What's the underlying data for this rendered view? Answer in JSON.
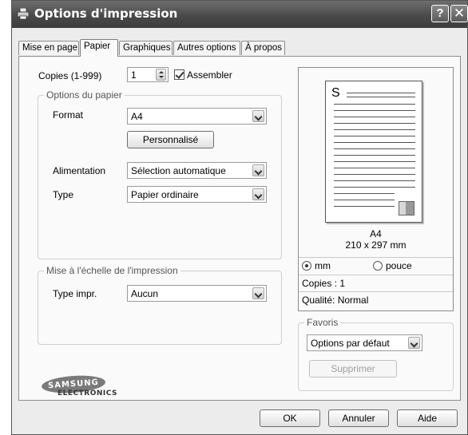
{
  "window": {
    "title": "Options d'impression",
    "help_glyph": "?",
    "close_glyph": "✕"
  },
  "tabs": [
    {
      "label": "Mise en page",
      "active": false
    },
    {
      "label": "Papier",
      "active": true
    },
    {
      "label": "Graphiques",
      "active": false
    },
    {
      "label": "Autres options",
      "active": false
    },
    {
      "label": "À propos",
      "active": false
    }
  ],
  "copies": {
    "label": "Copies (1-999)",
    "value": "1",
    "collate_label": "Assembler",
    "collate_checked": true
  },
  "paper_options": {
    "group_title": "Options du papier",
    "format_label": "Format",
    "format_value": "A4",
    "custom_button": "Personnalisé",
    "source_label": "Alimentation",
    "source_value": "Sélection automatique",
    "type_label": "Type",
    "type_value": "Papier ordinaire"
  },
  "scaling": {
    "group_title": "Mise à l'échelle de l'impression",
    "type_label": "Type impr.",
    "type_value": "Aucun"
  },
  "preview": {
    "page_letter": "S",
    "paper_name": "A4",
    "paper_size": "210 x 297 mm",
    "unit_mm": "mm",
    "unit_inch": "pouce",
    "unit_selected": "mm",
    "copies_text": "Copies : 1",
    "quality_text": "Qualité: Normal"
  },
  "favorites": {
    "group_title": "Favoris",
    "selected": "Options par défaut",
    "delete_button": "Supprimer"
  },
  "logo": {
    "brand": "SAMSUNG",
    "sub": "ELECTRONICS"
  },
  "footer": {
    "ok": "OK",
    "cancel": "Annuler",
    "help": "Aide"
  },
  "colors": {
    "titlebar": "#4a4a4a",
    "panel": "#fafafa",
    "dialog": "#ececec"
  }
}
